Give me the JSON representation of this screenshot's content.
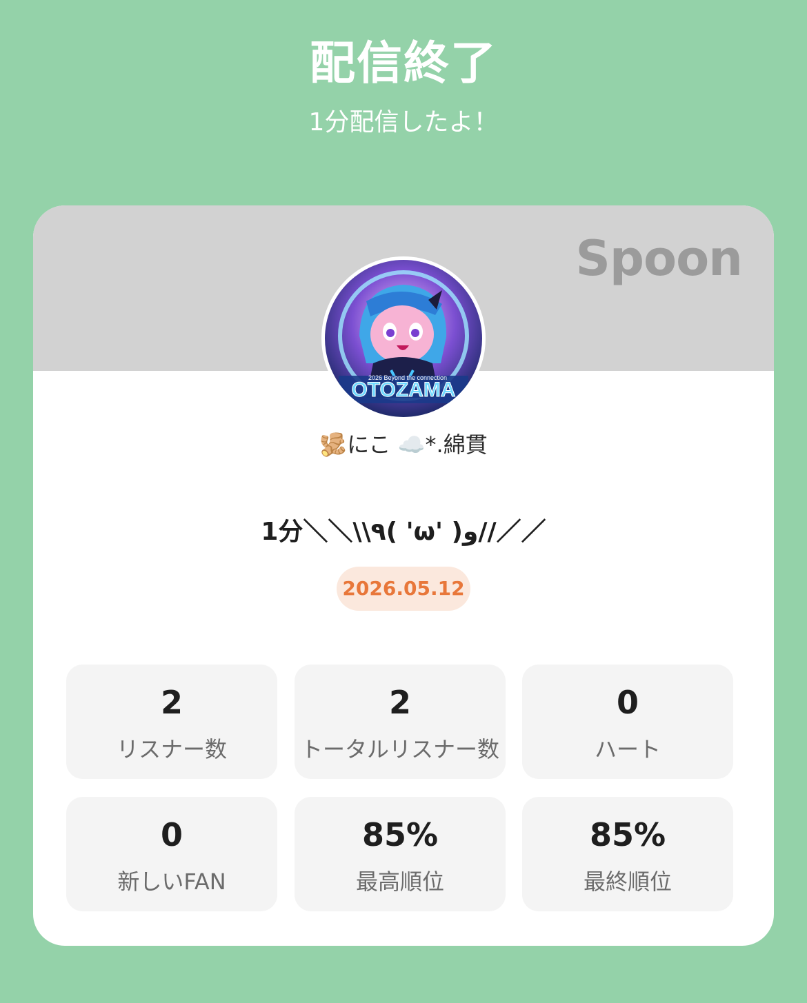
{
  "header": {
    "title": "配信終了",
    "subtitle": "1分配信したよ！"
  },
  "card": {
    "brand": "Spoon",
    "avatar": {
      "image": "anime-character-avatar",
      "caption_text": "OTOZAMA",
      "caption_sub": "2026 Beyond the connection"
    },
    "nickname": "🫚にこ ☁️*.綿貫",
    "stream_title": "1分＼＼\\\\٩( 'ω' )و//／／",
    "date": "2026.05.12",
    "stats": [
      {
        "value": "2",
        "label": "リスナー数"
      },
      {
        "value": "2",
        "label": "トータルリスナー数"
      },
      {
        "value": "0",
        "label": "ハート"
      },
      {
        "value": "0",
        "label": "新しいFAN"
      },
      {
        "value": "85%",
        "label": "最高順位"
      },
      {
        "value": "85%",
        "label": "最終順位"
      }
    ]
  },
  "colors": {
    "background": "#94d2a9",
    "card_header": "#d2d2d2",
    "date_text": "#e8773a",
    "date_badge": "#fbe8dd"
  }
}
